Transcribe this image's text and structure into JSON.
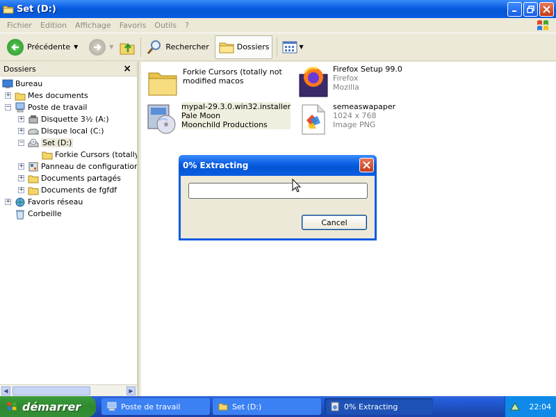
{
  "window": {
    "title": "Set (D:)"
  },
  "menu": [
    "Fichier",
    "Edition",
    "Affichage",
    "Favoris",
    "Outils",
    "?"
  ],
  "toolbar": {
    "back_label": "Précédente",
    "search_label": "Rechercher",
    "folders_label": "Dossiers"
  },
  "folders_pane": {
    "header": "Dossiers",
    "close_glyph": "×",
    "tree": [
      {
        "label": "Bureau",
        "icon": "desktop-icon"
      },
      {
        "label": "Mes documents",
        "icon": "folder-icon",
        "expander": "+"
      },
      {
        "label": "Poste de travail",
        "icon": "computer-icon",
        "expander": "−"
      },
      {
        "label": "Disquette 3½ (A:)",
        "icon": "floppy-icon",
        "expander": "+"
      },
      {
        "label": "Disque local (C:)",
        "icon": "drive-icon",
        "expander": "+"
      },
      {
        "label": "Set (D:)",
        "icon": "cd-drive-icon",
        "expander": "−",
        "selected": true
      },
      {
        "label": "Forkie Cursors (totally nc",
        "icon": "folder-icon"
      },
      {
        "label": "Panneau de configuration",
        "icon": "control-panel-icon",
        "expander": "+"
      },
      {
        "label": "Documents partagés",
        "icon": "folder-icon",
        "expander": "+"
      },
      {
        "label": "Documents de fgfdf",
        "icon": "folder-icon",
        "expander": "+"
      },
      {
        "label": "Favoris réseau",
        "icon": "network-icon",
        "expander": "+"
      },
      {
        "label": "Corbeille",
        "icon": "recycle-bin-icon"
      }
    ]
  },
  "files": [
    {
      "name": "Forkie Cursors (totally not",
      "line2": "modified macos",
      "line3": "",
      "icon": "folder-icon"
    },
    {
      "name": "Firefox Setup 99.0",
      "line2": "Firefox",
      "line3": "Mozilla",
      "icon": "firefox-installer-icon"
    },
    {
      "name": "mypal-29.3.0.win32.installer",
      "line2": "Pale Moon",
      "line3": "Moonchild Productions",
      "icon": "installer-cd-icon"
    },
    {
      "name": "semeaswapaper",
      "line2": "1024 x 768",
      "line3": "Image PNG",
      "icon": "png-image-icon"
    }
  ],
  "dialog": {
    "title": "0% Extracting",
    "progress": 0,
    "cancel_label": "Cancel"
  },
  "taskbar": {
    "start_label": "démarrer",
    "tasks": [
      {
        "label": "Poste de travail",
        "icon": "computer-icon"
      },
      {
        "label": "Set (D:)",
        "icon": "folder-icon"
      },
      {
        "label": "0% Extracting",
        "icon": "extract-icon",
        "active": true
      }
    ],
    "clock": "22:04"
  },
  "colors": {
    "titlebar": "#0a5ce3",
    "taskbar": "#245edb",
    "start": "#2f8a2f",
    "tray": "#0f8ae8"
  }
}
